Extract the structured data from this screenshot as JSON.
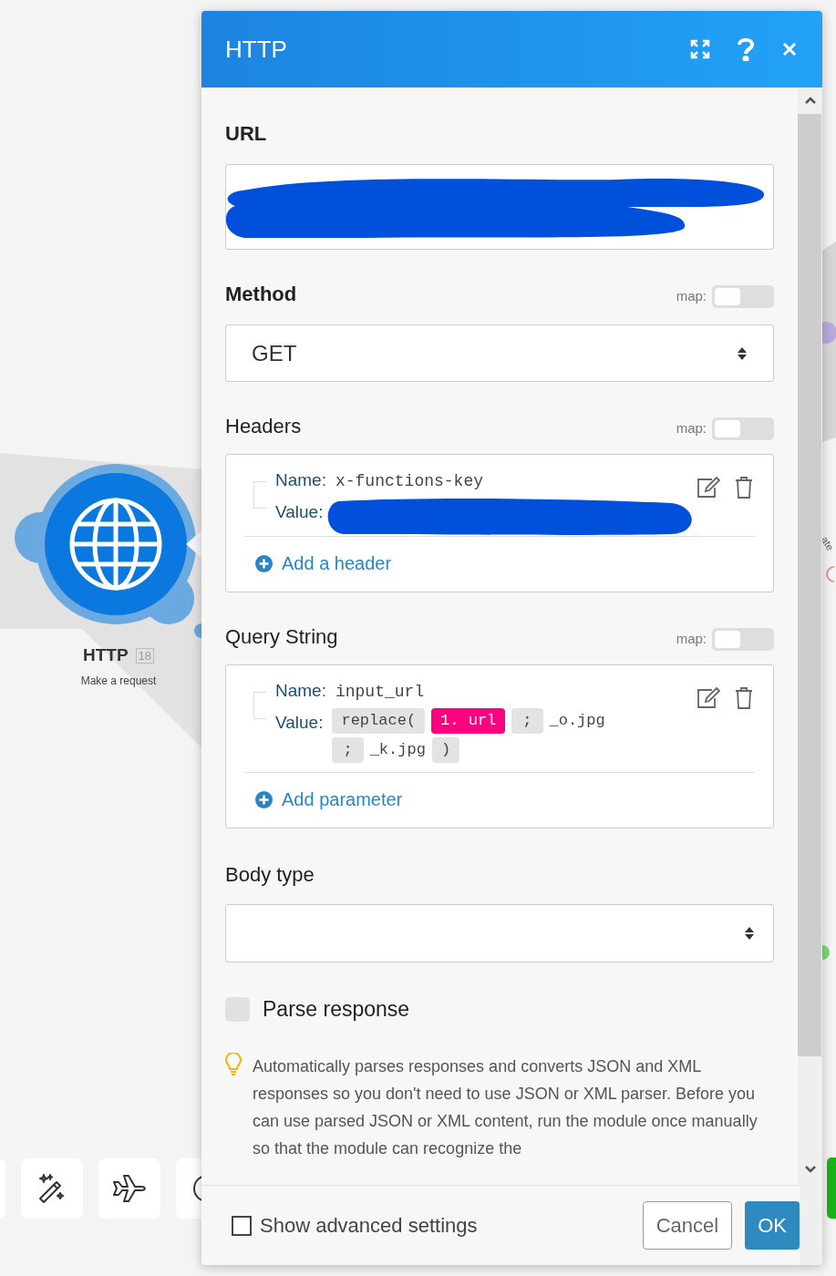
{
  "canvas": {
    "module": {
      "title": "HTTP",
      "badge": "18",
      "subtitle": "Make a request"
    },
    "edge_text": "ate"
  },
  "dialog": {
    "title": "HTTP",
    "url": {
      "label": "URL"
    },
    "method": {
      "label": "Method",
      "map_label": "map:",
      "map_on": false,
      "value": "GET"
    },
    "headers": {
      "label": "Headers",
      "map_label": "map:",
      "map_on": false,
      "items": [
        {
          "name_label": "Name:",
          "name": "x-functions-key",
          "value_label": "Value:"
        }
      ],
      "add": "Add a header"
    },
    "query_string": {
      "label": "Query String",
      "map_label": "map:",
      "map_on": false,
      "items": [
        {
          "name_label": "Name:",
          "name": "input_url",
          "value_label": "Value:",
          "value_tokens": [
            {
              "kind": "function",
              "text": "replace("
            },
            {
              "kind": "variable",
              "text": "1. url"
            },
            {
              "kind": "separator",
              "text": ";"
            },
            {
              "kind": "text",
              "text": "_o.jpg"
            },
            {
              "kind": "separator",
              "text": ";"
            },
            {
              "kind": "text",
              "text": "_k.jpg"
            },
            {
              "kind": "function",
              "text": ")"
            }
          ]
        }
      ],
      "add": "Add parameter"
    },
    "body_type": {
      "label": "Body type"
    },
    "parse_response": {
      "label": "Parse response",
      "checked": false
    },
    "hint": "Automatically parses responses and converts JSON and XML responses so you don't need to use JSON or XML parser. Before you can use parsed JSON or XML content, run the module once manually so that the module can recognize the",
    "footer": {
      "advanced": {
        "label": "Show advanced settings",
        "checked": false
      },
      "cancel": "Cancel",
      "ok": "OK"
    }
  }
}
